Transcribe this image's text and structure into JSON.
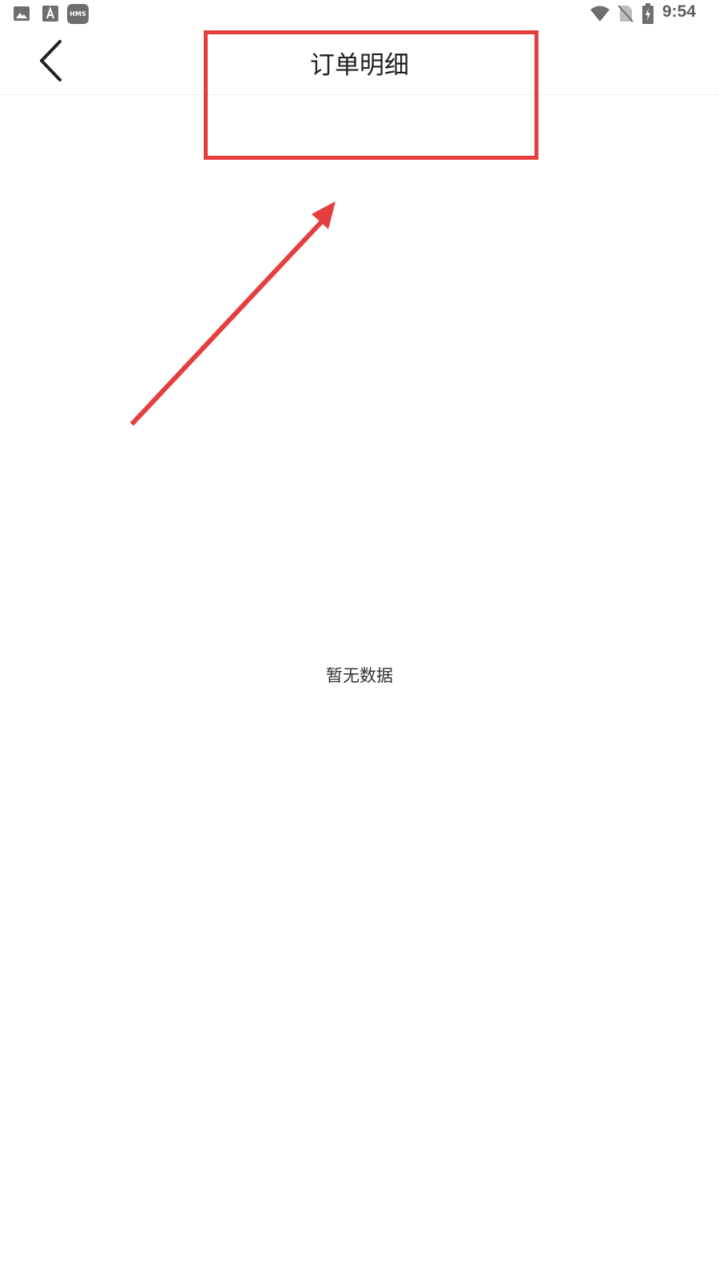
{
  "status_bar": {
    "time": "9:54",
    "hms_label": "HMS",
    "icons": [
      "gallery-icon",
      "font-icon",
      "hms-icon",
      "wifi-icon",
      "no-sim-icon",
      "battery-charging-icon"
    ]
  },
  "app_bar": {
    "title": "订单明细",
    "back_icon": "chevron-left-icon"
  },
  "content": {
    "empty_message": "暂无数据"
  },
  "annotation": {
    "color": "#e53e3f"
  }
}
